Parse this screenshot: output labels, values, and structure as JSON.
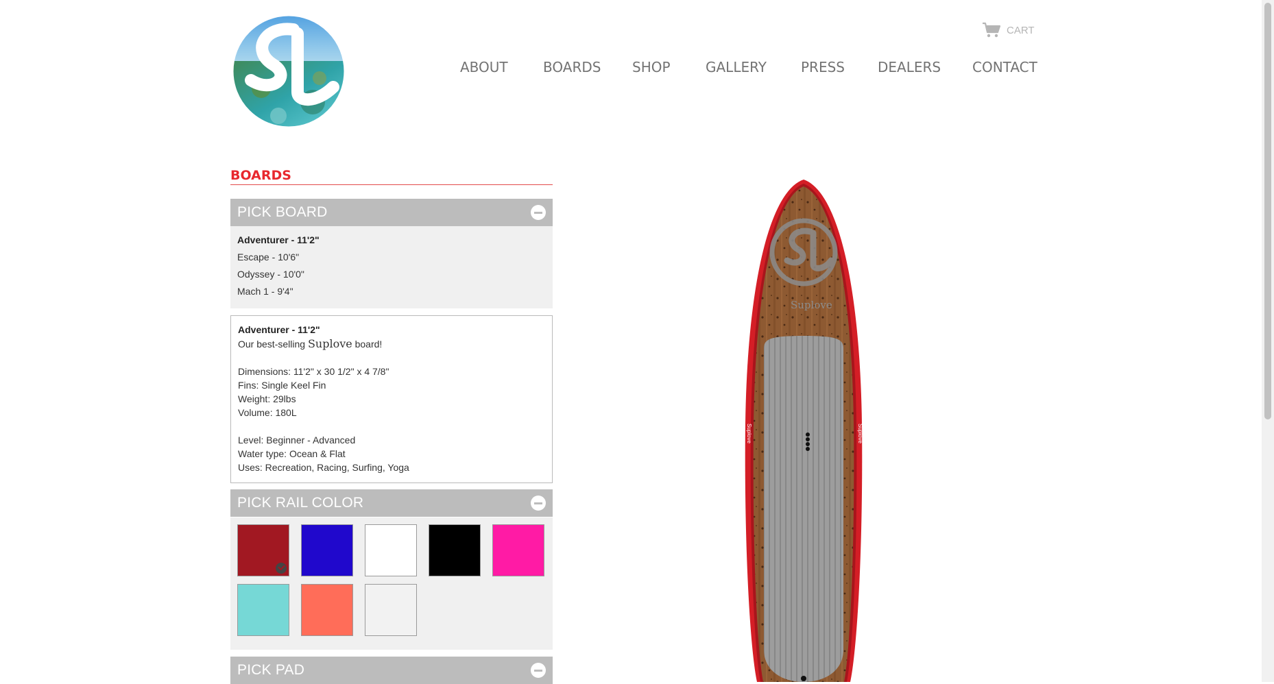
{
  "header": {
    "logo_icon": "suplove-sl-logo",
    "cart_label": "CART",
    "cart_icon": "cart-icon"
  },
  "nav": {
    "items": [
      "ABOUT",
      "BOARDS",
      "SHOP",
      "GALLERY",
      "PRESS",
      "DEALERS",
      "CONTACT"
    ]
  },
  "section": {
    "title": "BOARDS"
  },
  "pick_board": {
    "title": "PICK BOARD",
    "toggle_icon": "collapse-minus-icon",
    "boards": [
      "Adventurer - 11'2\"",
      "Escape - 10'6\"",
      "Odyssey - 10'0\"",
      "Mach 1 - 9'4\""
    ],
    "selected": "Adventurer - 11'2\""
  },
  "details": {
    "name": "Adventurer - 11'2\"",
    "tagline_prefix": "Our best-selling ",
    "tagline_brand": "Suplove",
    "tagline_suffix": " board!",
    "dimensions": "Dimensions: 11'2\" x 30 1/2\" x 4 7/8\"",
    "fins": "Fins: Single Keel Fin",
    "weight": "Weight: 29lbs",
    "volume": "Volume: 180L",
    "level": "Level: Beginner - Advanced",
    "water_type": "Water type: Ocean & Flat",
    "uses": "Uses: Recreation, Racing, Surfing, Yoga"
  },
  "pick_rail_color": {
    "title": "PICK RAIL COLOR",
    "toggle_icon": "collapse-minus-icon",
    "colors": [
      "#a11822",
      "#2008cc",
      "#ffffff",
      "#000000",
      "#ff1ba5",
      "#76d8d6",
      "#ff6d59",
      "#f2f2f2"
    ],
    "selected": "#a11822",
    "check_icon": "checkmark-icon"
  },
  "pick_pad": {
    "title": "PICK PAD",
    "toggle_icon": "collapse-minus-icon"
  },
  "board_preview": {
    "brand_text": "Suplove",
    "rail_color": "#d41e26",
    "deck_color": "#8e5a32",
    "pad_color": "#9d9d9d"
  }
}
